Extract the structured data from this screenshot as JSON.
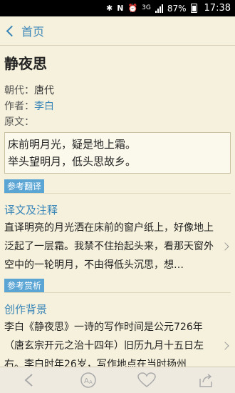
{
  "status_bar": {
    "battery": "87%",
    "time": "17:38",
    "network": "3G"
  },
  "nav": {
    "back_label": "首页"
  },
  "poem": {
    "title": "静夜思",
    "dynasty_label": "朝代：",
    "dynasty": "唐代",
    "author_label": "作者：",
    "author": "李白",
    "text_label": "原文：",
    "lines": [
      "床前明月光，疑是地上霜。",
      "举头望明月，低头思故乡。"
    ]
  },
  "sections": {
    "tag_translation": "参考翻译",
    "translation_title": "译文及注释",
    "translation_text": "直译明亮的月光洒在床前的窗户纸上，好像地上泛起了一层霜。我禁不住抬起头来，看那天窗外空中的一轮明月，不由得低头沉思，想…",
    "tag_appreciation": "参考赏析",
    "background_title": "创作背景",
    "background_text": "李白《静夜思》一诗的写作时间是公元726年（唐玄宗开元之治十四年）旧历九月十五日左右。李白时年26岁，写作地点在当时扬州"
  },
  "toolbar": {
    "icons": [
      "back-icon",
      "font-size-icon",
      "heart-icon",
      "share-icon"
    ]
  },
  "colors": {
    "accent": "#3a86b8",
    "background": "#f6f1dc",
    "tag": "#5aa5d4"
  }
}
